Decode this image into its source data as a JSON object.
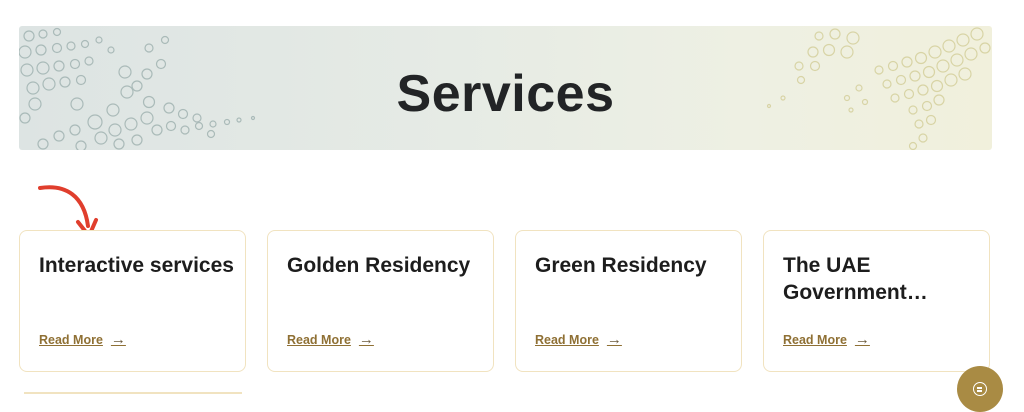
{
  "banner": {
    "title": "Services"
  },
  "services": [
    {
      "title": "Interactive services",
      "link_label": "Read More"
    },
    {
      "title": "Golden Residency",
      "link_label": "Read More"
    },
    {
      "title": "Green Residency",
      "link_label": "Read More"
    },
    {
      "title": "The UAE Government…",
      "link_label": "Read More"
    }
  ],
  "icons": {
    "read_more_arrow": "arrow-right-icon",
    "annotation": "red-curved-arrow-icon",
    "fab": "chat-icon"
  },
  "colors": {
    "accent": "#a98b44",
    "link": "#8f7034",
    "card_border": "#f1e3c0",
    "annotation": "#e03e2d"
  }
}
